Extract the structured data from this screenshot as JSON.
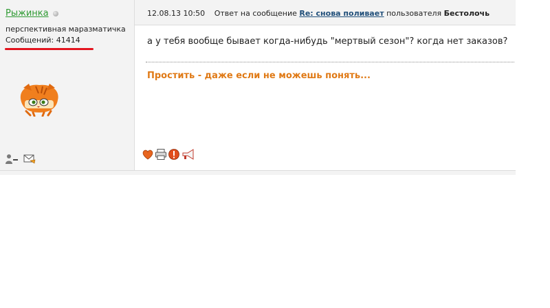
{
  "post": {
    "author": {
      "name": "Рыжинка",
      "rank": "перспективная маразматичка",
      "posts_line": "Сообщений: 41414",
      "online_status_icon": "offline-dot-icon",
      "avatar_icon": "orange-cat-avatar"
    },
    "header": {
      "datetime": "12.08.13 10:50",
      "reply_prefix": "Ответ на сообщение",
      "reply_title": "Re: снова поливает",
      "reply_user_prefix": "пользователя",
      "reply_user": "Бестолочь"
    },
    "body": "а у тебя вообще бывает когда-нибудь \"мертвый сезон\"? когда нет заказов?",
    "signature": "Простить - даже если не можешь понять...",
    "author_actions": [
      "profile-icon",
      "private-message-icon"
    ],
    "post_actions": [
      "heart-icon",
      "print-icon",
      "report-icon",
      "megaphone-icon"
    ]
  },
  "colors": {
    "author_name": "#2e9a32",
    "signature": "#e07a16",
    "annotation_underline": "#e3141f",
    "panel_bg": "#f3f3f3",
    "link": "#1f4e79"
  }
}
